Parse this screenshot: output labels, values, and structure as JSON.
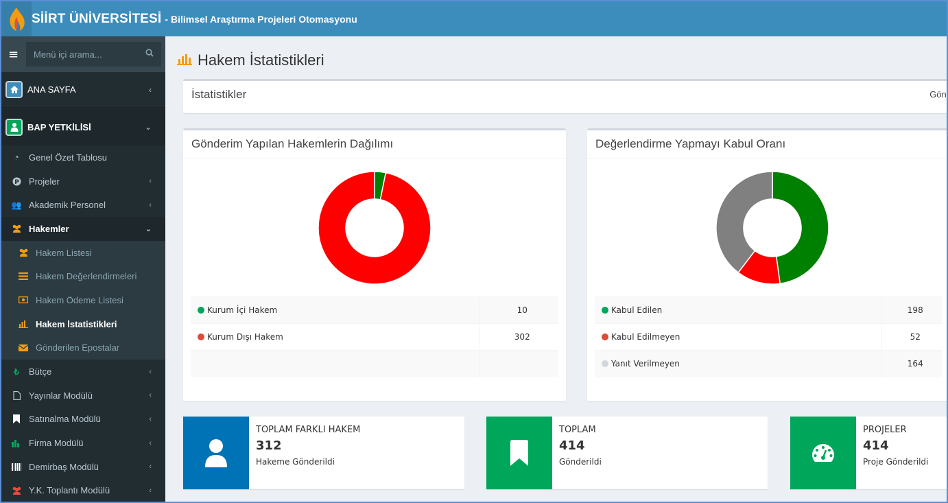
{
  "header": {
    "brand": "SİİRT ÜNİVERSİTESİ",
    "subtitle": "- Bilimsel Araştırma Projeleri Otomasyonu"
  },
  "sidebar": {
    "search_placeholder": "Menü içi arama...",
    "top_items": [
      {
        "label": "ANA SAYFA",
        "icon": "home-icon"
      },
      {
        "label": "BAP YETKİLİSİ",
        "icon": "user-icon"
      }
    ],
    "items": [
      {
        "label": "Genel Özet Tablosu",
        "icon": "dashboard-icon"
      },
      {
        "label": "Projeler",
        "icon": "p-circle-icon"
      },
      {
        "label": "Akademik Personel",
        "icon": "users-icon"
      },
      {
        "label": "Hakemler",
        "icon": "users-icon"
      },
      {
        "label": "Bütçe",
        "icon": "lira-icon"
      },
      {
        "label": "Yayınlar Modülü",
        "icon": "file-pdf-icon"
      },
      {
        "label": "Satınalma Modülü",
        "icon": "bookmark-icon"
      },
      {
        "label": "Firma Modülü",
        "icon": "chart-icon"
      },
      {
        "label": "Demirbaş Modülü",
        "icon": "barcode-icon"
      },
      {
        "label": "Y.K. Toplantı Modülü",
        "icon": "users-icon"
      }
    ],
    "sub_items": [
      {
        "label": "Hakem Listesi",
        "icon": "users-icon"
      },
      {
        "label": "Hakem Değerlendirmeleri",
        "icon": "list-icon"
      },
      {
        "label": "Hakem Ödeme Listesi",
        "icon": "money-icon"
      },
      {
        "label": "Hakem İstatistikleri",
        "icon": "bar-chart-icon"
      },
      {
        "label": "Gönderilen Epostalar",
        "icon": "envelope-icon"
      }
    ]
  },
  "page": {
    "title": "Hakem İstatistikleri",
    "stats_header": "İstatistikler",
    "stats_header_right": "Gönd"
  },
  "chart_data": [
    {
      "type": "pie",
      "title": "Gönderim Yapılan Hakemlerin Dağılımı",
      "categories": [
        "Kurum İçi Hakem",
        "Kurum Dışı Hakem"
      ],
      "values": [
        10,
        302
      ],
      "colors": [
        "#008000",
        "#ff0000"
      ]
    },
    {
      "type": "pie",
      "title": "Değerlendirme Yapmayı Kabul Oranı",
      "categories": [
        "Kabul Edilen",
        "Kabul Edilmeyen",
        "Yanıt Verilmeyen"
      ],
      "values": [
        198,
        52,
        164
      ],
      "colors": [
        "#008000",
        "#ff0000",
        "#808080"
      ],
      "legend_dot_colors": [
        "#00a65a",
        "#dd4b39",
        "#d2d6de"
      ]
    }
  ],
  "legend1": {
    "rows": [
      {
        "label": "Kurum İçi Hakem",
        "value": "10"
      },
      {
        "label": "Kurum Dışı Hakem",
        "value": "302"
      }
    ]
  },
  "legend2": {
    "rows": [
      {
        "label": "Kabul Edilen",
        "value": "198"
      },
      {
        "label": "Kabul Edilmeyen",
        "value": "52"
      },
      {
        "label": "Yanıt Verilmeyen",
        "value": "164"
      }
    ]
  },
  "info_boxes": [
    {
      "label": "TOPLAM FARKLI HAKEM",
      "number": "312",
      "desc": "Hakeme Gönderildi",
      "color": "#0073b7",
      "icon": "user-icon"
    },
    {
      "label": "TOPLAM",
      "number": "414",
      "desc": "Gönderildi",
      "color": "#00a65a",
      "icon": "bookmark-icon"
    },
    {
      "label": "PROJELER",
      "number": "414",
      "desc": "Proje Gönderildi",
      "color": "#00a65a",
      "icon": "dashboard-icon"
    }
  ],
  "colors": {
    "header_bg": "#3c8dbc",
    "sidebar_bg": "#222d32",
    "accent_orange": "#f39c12"
  }
}
